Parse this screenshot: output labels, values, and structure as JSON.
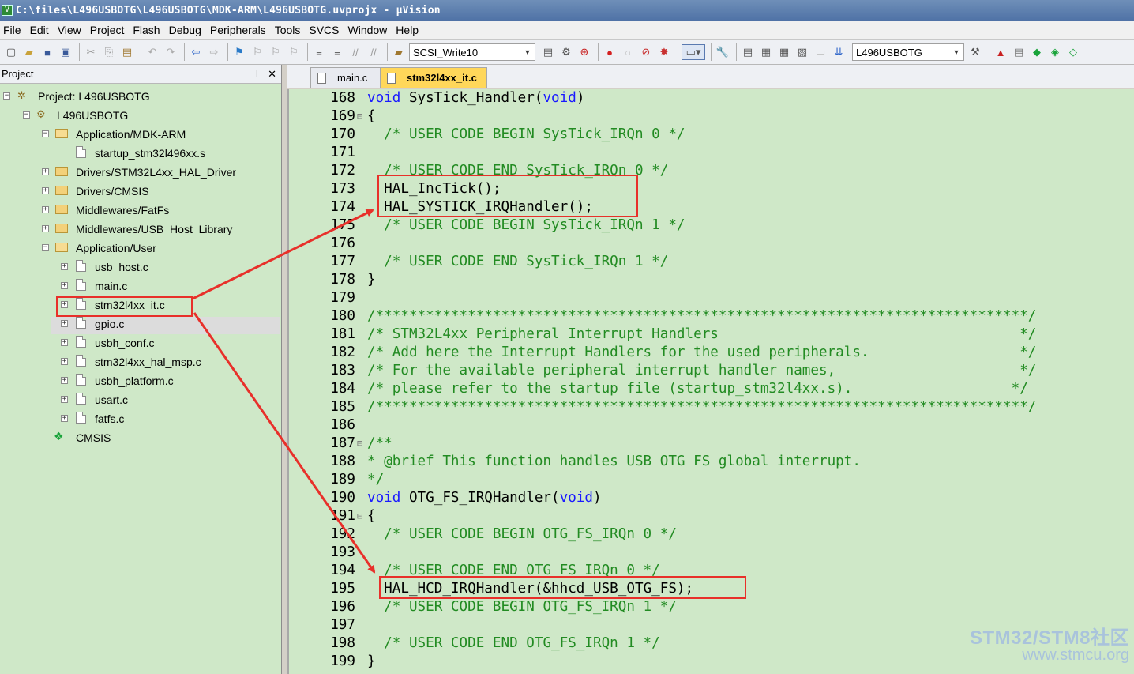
{
  "window": {
    "title": "C:\\files\\L496USBOTG\\L496USBOTG\\MDK-ARM\\L496USBOTG.uvprojx - µVision"
  },
  "menu": [
    "File",
    "Edit",
    "View",
    "Project",
    "Flash",
    "Debug",
    "Peripherals",
    "Tools",
    "SVCS",
    "Window",
    "Help"
  ],
  "toolbar": {
    "target_combo": "SCSI_Write10",
    "project_combo": "L496USBOTG"
  },
  "project_panel": {
    "title": "Project",
    "tree": [
      {
        "label": "Project: L496USBOTG"
      },
      {
        "label": "L496USBOTG"
      },
      {
        "label": "Application/MDK-ARM"
      },
      {
        "label": "startup_stm32l496xx.s"
      },
      {
        "label": "Drivers/STM32L4xx_HAL_Driver"
      },
      {
        "label": "Drivers/CMSIS"
      },
      {
        "label": "Middlewares/FatFs"
      },
      {
        "label": "Middlewares/USB_Host_Library"
      },
      {
        "label": "Application/User"
      },
      {
        "label": "usb_host.c"
      },
      {
        "label": "main.c"
      },
      {
        "label": "stm32l4xx_it.c"
      },
      {
        "label": "gpio.c"
      },
      {
        "label": "usbh_conf.c"
      },
      {
        "label": "stm32l4xx_hal_msp.c"
      },
      {
        "label": "usbh_platform.c"
      },
      {
        "label": "usart.c"
      },
      {
        "label": "fatfs.c"
      },
      {
        "label": "CMSIS"
      }
    ]
  },
  "editor": {
    "tabs": [
      "main.c",
      "stm32l4xx_it.c"
    ],
    "active_tab": "stm32l4xx_it.c",
    "lines": [
      {
        "n": "168",
        "fold": "",
        "parts": [
          [
            "kw",
            "void"
          ],
          [
            "pl",
            " SysTick_Handler("
          ],
          [
            "kw",
            "void"
          ],
          [
            "pl",
            ")"
          ]
        ]
      },
      {
        "n": "169",
        "fold": "⊟",
        "parts": [
          [
            "pl",
            "{"
          ]
        ]
      },
      {
        "n": "170",
        "fold": "",
        "parts": [
          [
            "cm",
            "  /* USER CODE BEGIN SysTick_IRQn 0 */"
          ]
        ]
      },
      {
        "n": "171",
        "fold": "",
        "parts": []
      },
      {
        "n": "172",
        "fold": "",
        "parts": [
          [
            "cm",
            "  /* USER CODE END SysTick_IRQn 0 */"
          ]
        ]
      },
      {
        "n": "173",
        "fold": "",
        "parts": [
          [
            "pl",
            "  HAL_IncTick();"
          ]
        ]
      },
      {
        "n": "174",
        "fold": "",
        "parts": [
          [
            "pl",
            "  HAL_SYSTICK_IRQHandler();"
          ]
        ]
      },
      {
        "n": "175",
        "fold": "",
        "parts": [
          [
            "cm",
            "  /* USER CODE BEGIN SysTick_IRQn 1 */"
          ]
        ]
      },
      {
        "n": "176",
        "fold": "",
        "parts": []
      },
      {
        "n": "177",
        "fold": "",
        "parts": [
          [
            "cm",
            "  /* USER CODE END SysTick_IRQn 1 */"
          ]
        ]
      },
      {
        "n": "178",
        "fold": "",
        "parts": [
          [
            "pl",
            "}"
          ]
        ]
      },
      {
        "n": "179",
        "fold": "",
        "parts": []
      },
      {
        "n": "180",
        "fold": "",
        "parts": [
          [
            "cm",
            "/******************************************************************************/"
          ]
        ]
      },
      {
        "n": "181",
        "fold": "",
        "parts": [
          [
            "cm",
            "/* STM32L4xx Peripheral Interrupt Handlers                                    */"
          ]
        ]
      },
      {
        "n": "182",
        "fold": "",
        "parts": [
          [
            "cm",
            "/* Add here the Interrupt Handlers for the used peripherals.                  */"
          ]
        ]
      },
      {
        "n": "183",
        "fold": "",
        "parts": [
          [
            "cm",
            "/* For the available peripheral interrupt handler names,                      */"
          ]
        ]
      },
      {
        "n": "184",
        "fold": "",
        "parts": [
          [
            "cm",
            "/* please refer to the startup file (startup_stm32l4xx.s).                   */"
          ]
        ]
      },
      {
        "n": "185",
        "fold": "",
        "parts": [
          [
            "cm",
            "/******************************************************************************/"
          ]
        ]
      },
      {
        "n": "186",
        "fold": "",
        "parts": []
      },
      {
        "n": "187",
        "fold": "⊟",
        "parts": [
          [
            "cm",
            "/**"
          ]
        ]
      },
      {
        "n": "188",
        "fold": "",
        "parts": [
          [
            "cm",
            "* @brief This function handles USB OTG FS global interrupt."
          ]
        ]
      },
      {
        "n": "189",
        "fold": "",
        "parts": [
          [
            "cm",
            "*/"
          ]
        ]
      },
      {
        "n": "190",
        "fold": "",
        "parts": [
          [
            "kw",
            "void"
          ],
          [
            "pl",
            " OTG_FS_IRQHandler("
          ],
          [
            "kw",
            "void"
          ],
          [
            "pl",
            ")"
          ]
        ]
      },
      {
        "n": "191",
        "fold": "⊟",
        "parts": [
          [
            "pl",
            "{"
          ]
        ]
      },
      {
        "n": "192",
        "fold": "",
        "parts": [
          [
            "cm",
            "  /* USER CODE BEGIN OTG_FS_IRQn 0 */"
          ]
        ]
      },
      {
        "n": "193",
        "fold": "",
        "parts": []
      },
      {
        "n": "194",
        "fold": "",
        "parts": [
          [
            "cm",
            "  /* USER CODE END OTG_FS_IRQn 0 */"
          ]
        ]
      },
      {
        "n": "195",
        "fold": "",
        "parts": [
          [
            "pl",
            "  HAL_HCD_IRQHandler(&hhcd_USB_OTG_FS);"
          ]
        ]
      },
      {
        "n": "196",
        "fold": "",
        "parts": [
          [
            "cm",
            "  /* USER CODE BEGIN OTG_FS_IRQn 1 */"
          ]
        ]
      },
      {
        "n": "197",
        "fold": "",
        "parts": []
      },
      {
        "n": "198",
        "fold": "",
        "parts": [
          [
            "cm",
            "  /* USER CODE END OTG_FS_IRQn 1 */"
          ]
        ]
      },
      {
        "n": "199",
        "fold": "",
        "parts": [
          [
            "pl",
            "}"
          ]
        ]
      }
    ]
  },
  "watermark": {
    "line1": "STM32/STM8社区",
    "line2": "www.stmcu.org"
  },
  "colors": {
    "editor_bg": "#cfe8c8",
    "keyword": "#1a1aff",
    "comment": "#228b22",
    "highlight_box": "#e8302a"
  }
}
